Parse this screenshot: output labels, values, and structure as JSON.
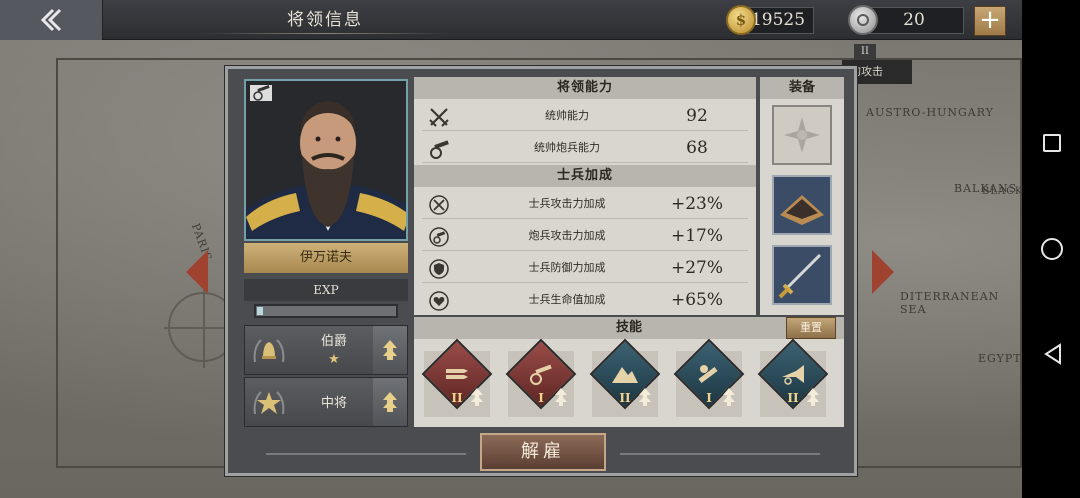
{
  "topbar": {
    "title": "将领信息",
    "gold": "19525",
    "gold_symbol": "$",
    "medals": "20",
    "add_label": "+"
  },
  "map": {
    "labels": [
      "AUSTRO-HUNGARY",
      "BALKANS",
      "DITERRANEAN SEA",
      "EGYPT",
      "BLACK",
      "PARIS"
    ],
    "attack_tag": "的攻击",
    "badge": "II"
  },
  "general": {
    "name": "伊万诺夫",
    "exp_label": "EXP",
    "exp_progress": 0.03,
    "ranks": [
      {
        "title": "伯爵",
        "stars": "★"
      },
      {
        "title": "中将",
        "stars": ""
      }
    ]
  },
  "abilities": {
    "header": "将领能力",
    "rows": [
      {
        "label": "统帅能力",
        "value": "92",
        "icon": "crossed-swords-icon"
      },
      {
        "label": "统帅炮兵能力",
        "value": "68",
        "icon": "cannon-icon"
      }
    ]
  },
  "bonuses": {
    "header": "士兵加成",
    "rows": [
      {
        "label": "士兵攻击力加成",
        "value": "+23%",
        "icon": "sword-plus-icon"
      },
      {
        "label": "炮兵攻击力加成",
        "value": "+17%",
        "icon": "cannon-plus-icon"
      },
      {
        "label": "士兵防御力加成",
        "value": "+27%",
        "icon": "shield-plus-icon"
      },
      {
        "label": "士兵生命值加成",
        "value": "+65%",
        "icon": "heart-plus-icon"
      }
    ]
  },
  "equipment": {
    "header": "装备",
    "slots": [
      "medal-icon",
      "terrain-icon",
      "saber-icon"
    ]
  },
  "skills": {
    "header": "技能",
    "reset_label": "重置",
    "items": [
      {
        "level": "II",
        "color": "red",
        "icon": "bullets-icon"
      },
      {
        "level": "I",
        "color": "red",
        "icon": "artillery-icon"
      },
      {
        "level": "II",
        "color": "teal",
        "icon": "mountain-icon"
      },
      {
        "level": "I",
        "color": "teal",
        "icon": "scroll-icon"
      },
      {
        "level": "II",
        "color": "teal",
        "icon": "bugle-icon"
      }
    ]
  },
  "footer": {
    "dismiss_label": "解雇"
  },
  "colors": {
    "accent_gold": "#cdb27a",
    "skill_red": "#9a4c48",
    "skill_teal": "#3c6272",
    "dismiss": "#8c6a58"
  }
}
